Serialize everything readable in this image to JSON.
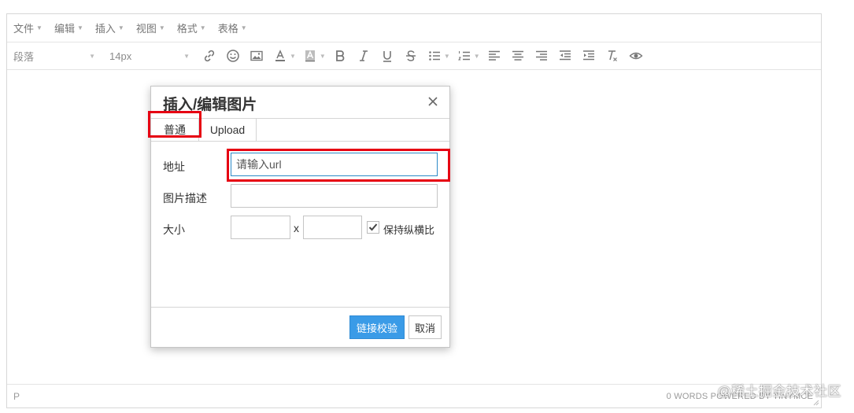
{
  "menubar": {
    "items": [
      {
        "label": "文件"
      },
      {
        "label": "编辑"
      },
      {
        "label": "插入"
      },
      {
        "label": "视图"
      },
      {
        "label": "格式"
      },
      {
        "label": "表格"
      }
    ]
  },
  "toolbar": {
    "block_format": "段落",
    "font_size": "14px",
    "buttons": [
      "link-icon",
      "emoticons-icon",
      "image-icon",
      "text-color-icon",
      "background-color-icon",
      "bold-icon",
      "italic-icon",
      "underline-icon",
      "strikethrough-icon",
      "bullet-list-icon",
      "numbered-list-icon",
      "align-left-icon",
      "align-center-icon",
      "align-right-icon",
      "outdent-icon",
      "indent-icon",
      "clear-formatting-icon",
      "preview-icon"
    ]
  },
  "statusbar": {
    "path": "P",
    "words": "0 WORDS POWERED BY TINYMCE"
  },
  "watermark": "@稀土掘金技术社区",
  "dialog": {
    "title": "插入/编辑图片",
    "tabs": [
      {
        "label": "普通"
      },
      {
        "label": "Upload"
      }
    ],
    "fields": {
      "url_label": "地址",
      "url_placeholder": "请输入url",
      "description_label": "图片描述",
      "description_value": "",
      "size_label": "大小",
      "width_value": "",
      "height_value": "",
      "size_separator": "x",
      "constrain_label": "保持纵横比",
      "constrain_checked": true
    },
    "buttons": {
      "primary": "链接校验",
      "cancel": "取消"
    }
  },
  "colors": {
    "primary_button": "#3a9be7",
    "annotation": "#e60012",
    "focus_border": "#2d8ac7"
  }
}
